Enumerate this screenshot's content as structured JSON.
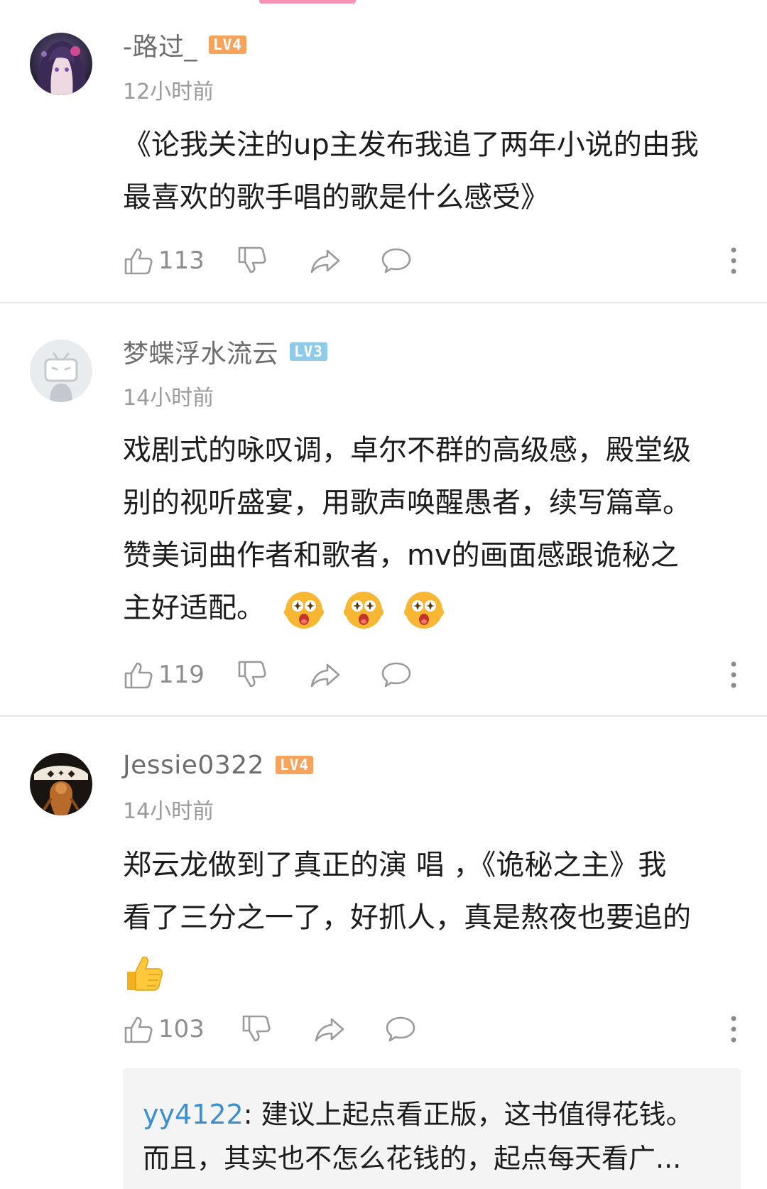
{
  "comments": [
    {
      "username": "-路过_",
      "level": "LV4",
      "timestamp": "12小时前",
      "body_lines": [
        "《论我关注的up主发布我追了两年小说的由我",
        "最喜欢的歌手唱的歌是什么感受》"
      ],
      "likes": "113",
      "avatar_icon": "anime-girl-avatar"
    },
    {
      "username": "梦蝶浮水流云",
      "level": "LV3",
      "timestamp": "14小时前",
      "body_lines": [
        "戏剧式的咏叹调，卓尔不群的高级感，殿堂级",
        "别的视听盛宴，用歌声唤醒愚者，续写篇章。",
        "赞美词曲作者和歌者，mv的画面感跟诡秘之",
        "主好适配。"
      ],
      "emojis": [
        "starry-eyed-face-emoji",
        "starry-eyed-face-emoji",
        "starry-eyed-face-emoji"
      ],
      "likes": "119",
      "avatar_icon": "bilibili-tv-default-avatar"
    },
    {
      "username": "Jessie0322",
      "level": "LV4",
      "timestamp": "14小时前",
      "body_lines": [
        "郑云龙做到了真正的演  唱  ，《诡秘之主》我",
        "看了三分之一了，好抓人，真是熬夜也要追的"
      ],
      "emojis": [
        "thumbs-up-emoji"
      ],
      "likes": "103",
      "avatar_icon": "artwork-avatar",
      "reply": {
        "user": "yy4122",
        "line1": ": 建议上起点看正版，这书值得花钱。",
        "line2": "而且，其实也不怎么花钱的，起点每天看广..."
      }
    }
  ],
  "colors": {
    "accent_pink": "#f493b2",
    "lv4_badge": "#f6a35e",
    "lv3_badge": "#8fcbe8",
    "reply_user": "#3a8fd0",
    "icon_gray": "#9a9a9a"
  }
}
